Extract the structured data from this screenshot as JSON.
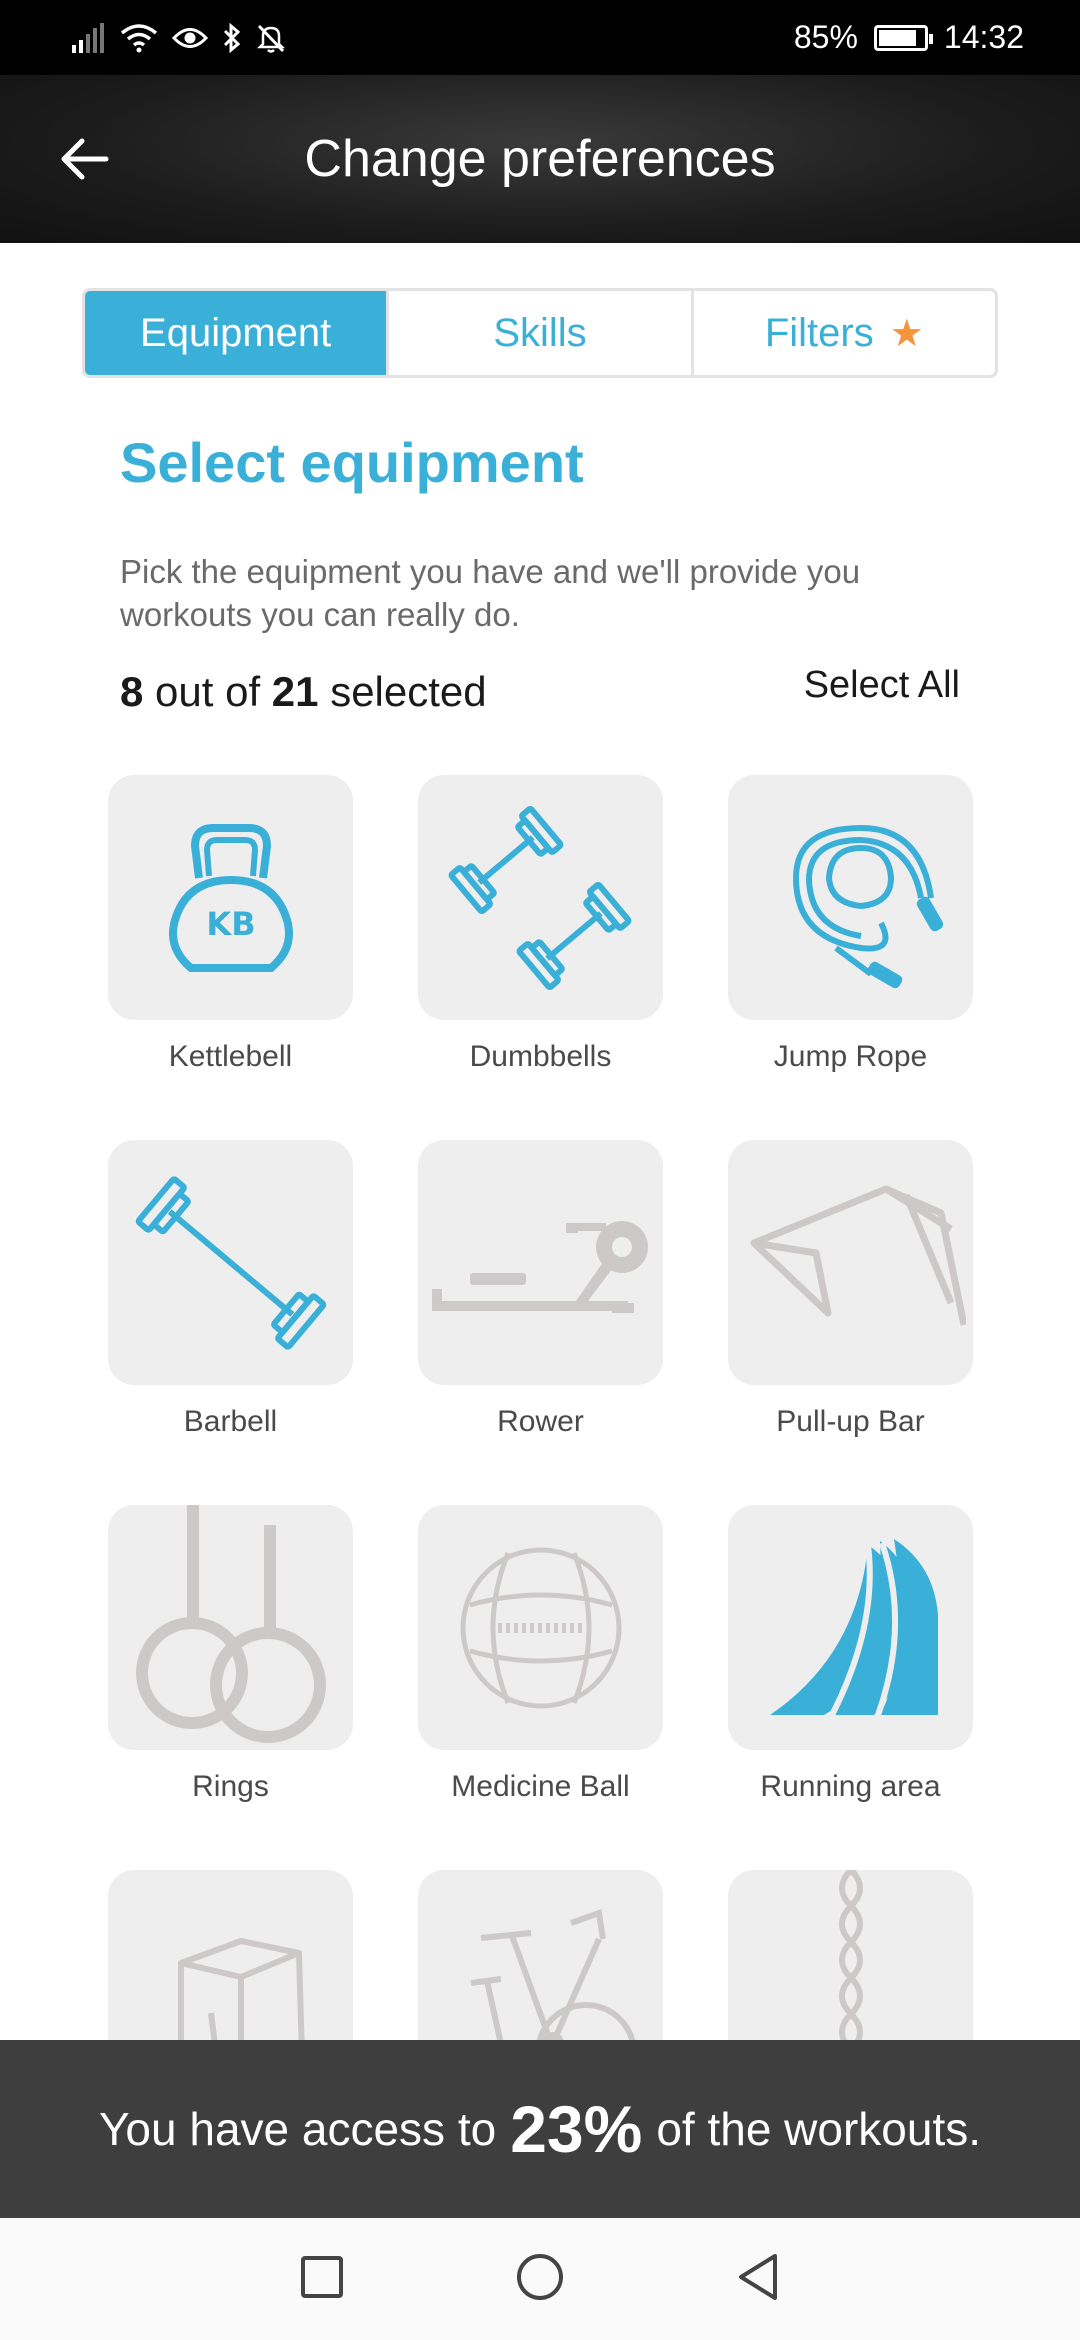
{
  "status_bar": {
    "battery": "85%",
    "battery_level": 0.85,
    "time": "14:32",
    "icons": [
      "signal-icon",
      "wifi-icon",
      "eye-icon",
      "bluetooth-icon",
      "notifications-off-icon",
      "battery-icon"
    ]
  },
  "header": {
    "title": "Change preferences",
    "back_icon": "arrow-left-icon"
  },
  "tabs": [
    {
      "label": "Equipment",
      "active": true
    },
    {
      "label": "Skills",
      "active": false
    },
    {
      "label": "Filters",
      "active": false,
      "badge_icon": "star-icon"
    }
  ],
  "section": {
    "title": "Select equipment",
    "description": "Pick the equipment you have and we'll provide you workouts you can really do.",
    "count_selected": "8",
    "count_text_1": "out of",
    "count_total": "21",
    "count_text_2": "selected",
    "select_all_label": "Select All"
  },
  "equipment": [
    {
      "label": "Kettlebell",
      "icon": "kettlebell-icon",
      "selected": true
    },
    {
      "label": "Dumbbells",
      "icon": "dumbbells-icon",
      "selected": true
    },
    {
      "label": "Jump Rope",
      "icon": "jump-rope-icon",
      "selected": true
    },
    {
      "label": "Barbell",
      "icon": "barbell-icon",
      "selected": true
    },
    {
      "label": "Rower",
      "icon": "rower-icon",
      "selected": false
    },
    {
      "label": "Pull-up Bar",
      "icon": "pull-up-bar-icon",
      "selected": false
    },
    {
      "label": "Rings",
      "icon": "rings-icon",
      "selected": false
    },
    {
      "label": "Medicine Ball",
      "icon": "medicine-ball-icon",
      "selected": false
    },
    {
      "label": "Running area",
      "icon": "running-area-icon",
      "selected": true
    },
    {
      "label": "",
      "icon": "plyo-box-icon",
      "selected": false
    },
    {
      "label": "",
      "icon": "exercise-bike-icon",
      "selected": false
    },
    {
      "label": "",
      "icon": "climbing-rope-icon",
      "selected": false
    }
  ],
  "banner": {
    "text_before": "You have access to",
    "percent": "23%",
    "text_after": "of the workouts."
  },
  "navbar": {
    "icons": [
      "recent-apps-icon",
      "home-icon",
      "back-icon"
    ]
  },
  "colors": {
    "accent": "#3ab0d8",
    "star": "#f5943a",
    "unselected_icon": "#cdc9c9",
    "tile_bg": "#eeeeee",
    "banner_bg": "#3e3e3e"
  }
}
